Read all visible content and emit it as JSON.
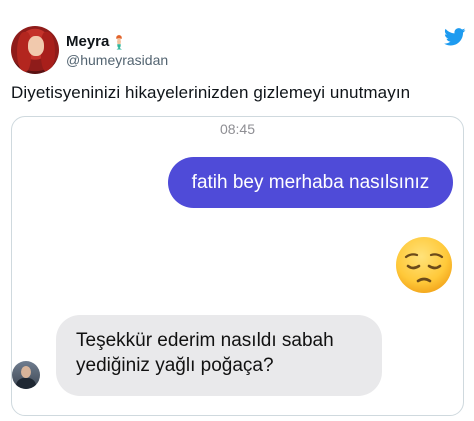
{
  "tweet": {
    "author_name": "Meyra",
    "author_handle": "@humeyrasidan",
    "text": "Diyetisyeninizi hikayelerinizden gizlemeyi unutmayın",
    "avatar_icon": "profile-photo",
    "name_emoji": "mermaid-emoji",
    "brand_icon": "twitter-bird-icon",
    "brand_color": "#1d9bf0"
  },
  "chat": {
    "time": "08:45",
    "outgoing_message": "fatih bey merhaba nasılsınız",
    "outgoing_color": "#4f4bd8",
    "reaction_emoji": "pensive-face-emoji",
    "incoming_message_lines": [
      "Teşekkür ederim nasıldı sabah",
      "yediğiniz yağlı poğaça?"
    ],
    "incoming_color": "#e9e9eb"
  }
}
